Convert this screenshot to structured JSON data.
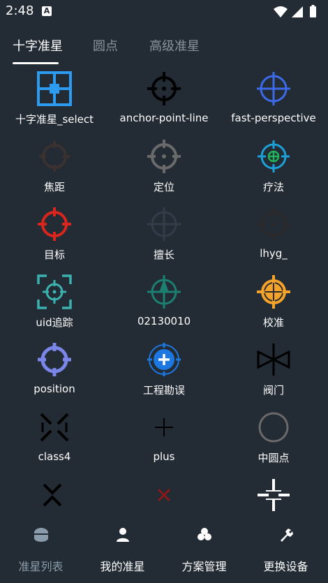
{
  "status": {
    "time": "2:48",
    "badge": "A"
  },
  "tabs": [
    {
      "label": "十字准星"
    },
    {
      "label": "圆点"
    },
    {
      "label": "高级准星"
    }
  ],
  "items": [
    {
      "label": "十字准星_select",
      "icon": "crosshair-select-icon",
      "color": "#2d9cf0"
    },
    {
      "label": "anchor-point-line",
      "icon": "anchor-crosshair-icon",
      "color": "#000000"
    },
    {
      "label": "fast-perspective",
      "icon": "blue-crosshair-icon",
      "color": "#3d6ae8"
    },
    {
      "label": "焦距",
      "icon": "focus-crosshair-icon",
      "color": "#3a3130"
    },
    {
      "label": "定位",
      "icon": "locate-crosshair-icon",
      "color": "#6a6a6a"
    },
    {
      "label": "疗法",
      "icon": "therapy-crosshair-icon",
      "color": "#1e9fd8"
    },
    {
      "label": "目标",
      "icon": "target-crosshair-icon",
      "color": "#d8261c"
    },
    {
      "label": "擅长",
      "icon": "skill-crosshair-icon",
      "color": "#333c4a"
    },
    {
      "label": "lhyg_",
      "icon": "lhyg-crosshair-icon",
      "color": "#2c2a2a"
    },
    {
      "label": "uid追踪",
      "icon": "tracking-frame-icon",
      "color": "#3ab3b0"
    },
    {
      "label": "02130010",
      "icon": "arrow-crosshair-icon",
      "color": "#1b7f72"
    },
    {
      "label": "校准",
      "icon": "calibrate-crosshair-icon",
      "color": "#f3a32c"
    },
    {
      "label": "position",
      "icon": "position-crosshair-icon",
      "color": "#7a86e8"
    },
    {
      "label": "工程勘误",
      "icon": "plus-circle-crosshair-icon",
      "color": "#1c78e0"
    },
    {
      "label": "阀门",
      "icon": "valve-icon",
      "color": "#000000"
    },
    {
      "label": "class4",
      "icon": "x-crosshair-icon",
      "color": "#000000"
    },
    {
      "label": "plus",
      "icon": "plus-icon",
      "color": "#000000"
    },
    {
      "label": "中圆点",
      "icon": "ring-icon",
      "color": "#6a6a6a"
    },
    {
      "label": "",
      "icon": "chevron-x-icon",
      "color": "#000000"
    },
    {
      "label": "",
      "icon": "small-x-icon",
      "color": "#8a1a1a"
    },
    {
      "label": "",
      "icon": "gap-crosshair-icon",
      "color": "#ffffff"
    }
  ],
  "nav": [
    {
      "label": "准星列表",
      "icon": "crosshair-list-icon"
    },
    {
      "label": "我的准星",
      "icon": "user-icon"
    },
    {
      "label": "方案管理",
      "icon": "scheme-icon"
    },
    {
      "label": "更换设备",
      "icon": "device-icon"
    }
  ]
}
